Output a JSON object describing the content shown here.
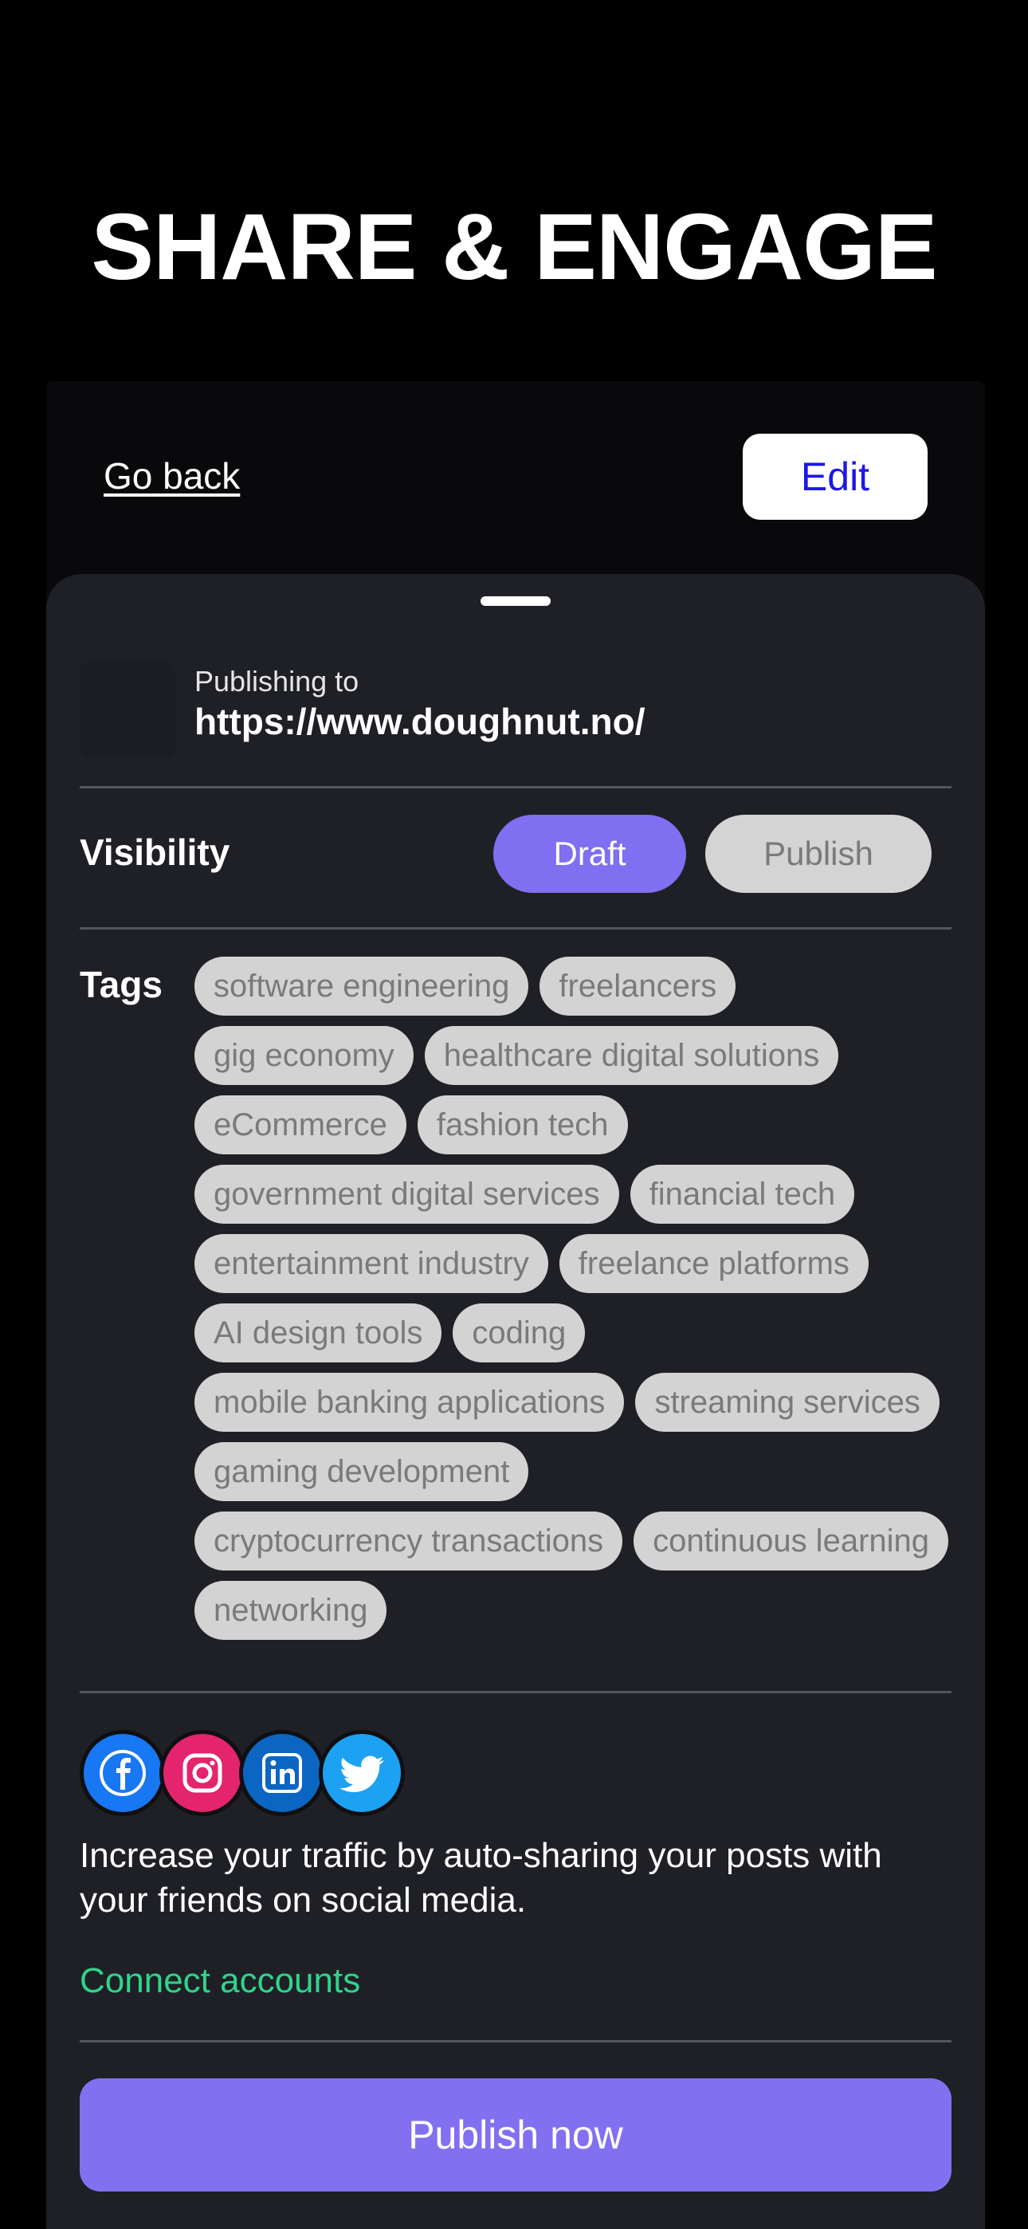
{
  "header": {
    "title": "SHARE & ENGAGE"
  },
  "nav": {
    "back_label": "Go back",
    "edit_label": "Edit"
  },
  "publishing": {
    "label": "Publishing to",
    "url": "https://www.doughnut.no/"
  },
  "visibility": {
    "label": "Visibility",
    "draft_label": "Draft",
    "publish_label": "Publish",
    "selected": "Draft"
  },
  "tags": {
    "label": "Tags",
    "items": [
      "software engineering",
      "freelancers",
      "gig economy",
      "healthcare digital solutions",
      "eCommerce",
      "fashion tech",
      "government digital services",
      "financial tech",
      "entertainment industry",
      "freelance platforms",
      "AI design tools",
      "coding",
      "mobile banking applications",
      "streaming services",
      "gaming development",
      "cryptocurrency transactions",
      "continuous learning",
      "networking"
    ]
  },
  "social": {
    "icons": [
      "facebook-icon",
      "instagram-icon",
      "linkedin-icon",
      "twitter-icon"
    ],
    "description": "Increase your traffic by auto-sharing your posts with your friends on social media.",
    "connect_label": "Connect accounts"
  },
  "actions": {
    "publish_now_label": "Publish now"
  },
  "colors": {
    "accent": "#8270f1",
    "link_green": "#2fd48c",
    "edit_text": "#1d17e6"
  }
}
